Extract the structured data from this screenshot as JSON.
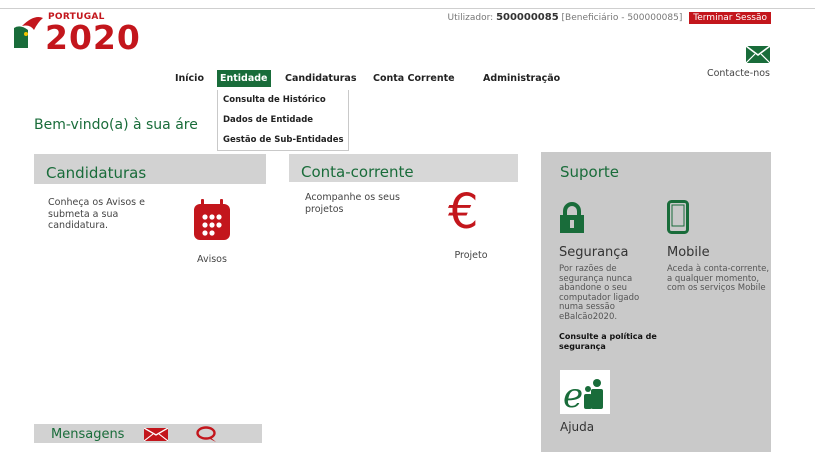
{
  "logo": {
    "small_text": "PORTUGAL",
    "big_text": "2020"
  },
  "userbar": {
    "prefix": "Utilizador: ",
    "user_id": "500000085",
    "role": " [Beneficiário - 500000085]",
    "logout_label": "Terminar Sessão"
  },
  "contact": {
    "label": "Contacte-nos",
    "icon": "mail-icon"
  },
  "nav": {
    "items": [
      {
        "label": "Início"
      },
      {
        "label": "Entidade"
      },
      {
        "label": "Candidaturas"
      },
      {
        "label": "Conta Corrente"
      },
      {
        "label": "Administração"
      }
    ],
    "dropdown": [
      {
        "label": "Consulta de Histórico"
      },
      {
        "label": "Dados de Entidade"
      },
      {
        "label": "Gestão de Sub-Entidades"
      }
    ]
  },
  "welcome": "Bem-vindo(a) à sua áre",
  "candidaturas": {
    "title": "Candidaturas",
    "text": "Conheça os Avisos e submeta a sua candidatura.",
    "avisos_label": "Avisos"
  },
  "conta_corrente": {
    "title": "Conta-corrente",
    "text": "Acompanhe os seus projetos",
    "euro_symbol": "€",
    "projeto_label": "Projeto"
  },
  "suporte": {
    "title": "Suporte",
    "seguranca": {
      "title": "Segurança",
      "text": "Por razões de segurança nunca abandone o seu computador ligado numa sessão eBalcão2020.",
      "link": "Consulte a política de segurança"
    },
    "mobile": {
      "title": "Mobile",
      "text": "Aceda à conta-corrente, a qualquer momento, com os serviços Mobile"
    },
    "ajuda": {
      "label": "Ajuda"
    }
  },
  "mensagens": {
    "label": "Mensagens"
  },
  "colors": {
    "brand_red": "#c3161c",
    "brand_green": "#196c3a",
    "panel_gray": "#c9c9c9"
  }
}
